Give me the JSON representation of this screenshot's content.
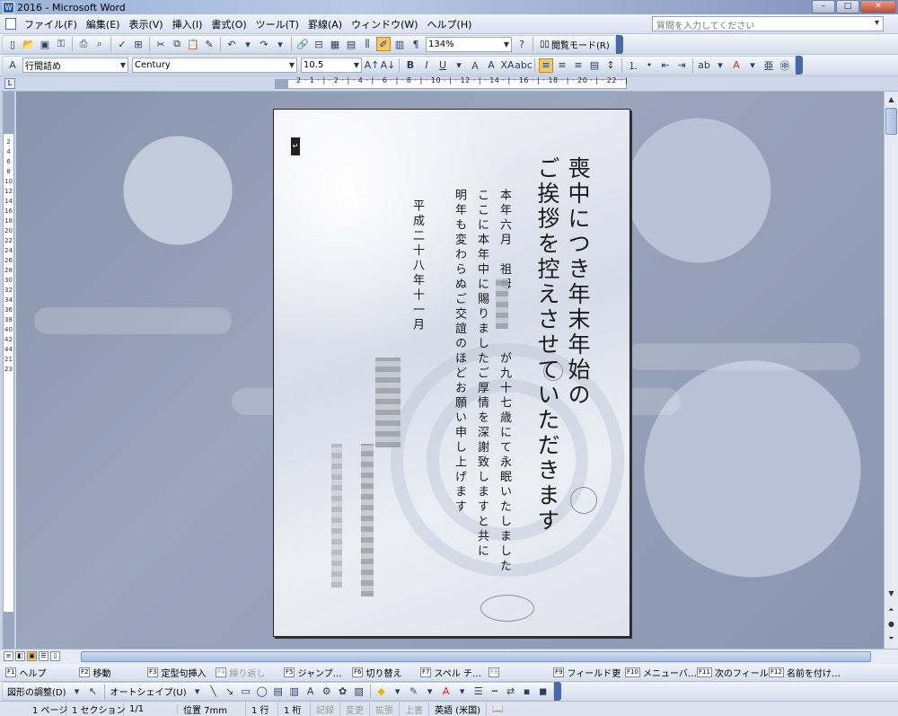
{
  "window": {
    "doc_name": "2016",
    "app_title": " - Microsoft Word",
    "buttons": {
      "minimize": "–",
      "restore": "□",
      "close": "✕"
    }
  },
  "menu": {
    "items": [
      "ファイル(F)",
      "編集(E)",
      "表示(V)",
      "挿入(I)",
      "書式(O)",
      "ツール(T)",
      "罫線(A)",
      "ウィンドウ(W)",
      "ヘルプ(H)"
    ],
    "question_placeholder": "質問を入力してください"
  },
  "toolbar_standard": {
    "zoom": "134%",
    "read_mode": "閲覧モード(R)"
  },
  "toolbar_format": {
    "style": "行間詰め",
    "font": "Century",
    "size": "10.5"
  },
  "ruler": {
    "numbers": "2 · 1 · | · 2 · | · 4 · | · 6 · | · 8 · | · 10 · | · 12 · | · 14 · | · 16 · | · 18 · | · 20 · | · 22 · |",
    "vertical_numbers": "2 4 6 8 10 12 14 16 18 20 22 24 26 28 30 32 34 36 38 40 42 44 21 23"
  },
  "document": {
    "heading_line1": "喪中につき年末年始の",
    "heading_line2": "ご挨拶を控えさせていただきます",
    "body_line1": "本年六月　祖母　　　　が九十七歳にて永眠いたしました",
    "body_line2": "ここに本年中に賜りましたご厚情を深謝致しますと共に",
    "body_line3": "明年も変わらぬご交誼のほどお願い申し上げます",
    "date_line": "平成二十八年十一月"
  },
  "fkeys": [
    {
      "key": "F1",
      "label": "ヘルプ",
      "dim": false
    },
    {
      "key": "F2",
      "label": "移動",
      "dim": false
    },
    {
      "key": "F3",
      "label": "定型句挿入",
      "dim": false
    },
    {
      "key": "F4",
      "label": "繰り返し",
      "dim": true
    },
    {
      "key": "F5",
      "label": "ジャンプ…",
      "dim": false
    },
    {
      "key": "F6",
      "label": "切り替え",
      "dim": false
    },
    {
      "key": "F7",
      "label": "スペル チ…",
      "dim": false
    },
    {
      "key": "F8",
      "label": "",
      "dim": true
    },
    {
      "key": "F9",
      "label": "フィールド更",
      "dim": false
    },
    {
      "key": "F10",
      "label": "メニューバ…",
      "dim": false
    },
    {
      "key": "F11",
      "label": "次のフィール",
      "dim": false
    },
    {
      "key": "F12",
      "label": "名前を付け…",
      "dim": false
    }
  ],
  "drawbar": {
    "draw_label": "図形の調整(D)",
    "autoshape_label": "オートシェイプ(U)"
  },
  "status": {
    "page": "1 ページ",
    "section": "1 セクション",
    "pages": "1/1",
    "position": "位置 7mm",
    "line": "1 行",
    "column": "1 桁",
    "rec": "記録",
    "trk": "変更",
    "ext": "拡張",
    "ovr": "上書",
    "lang": "英語 (米国)"
  },
  "colors": {
    "title_bar": "#9ab3d8",
    "workspace": "#8894ad",
    "highlight": "#f5c76a"
  }
}
